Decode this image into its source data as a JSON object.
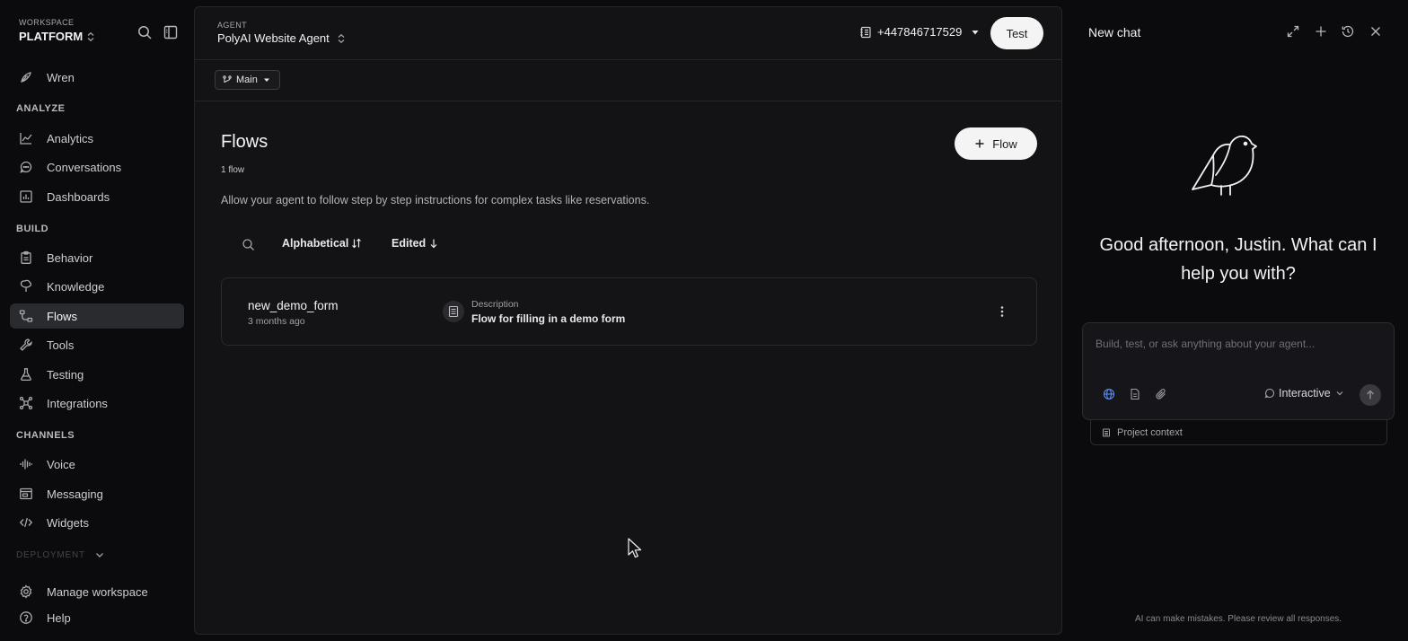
{
  "workspace": {
    "label": "WORKSPACE",
    "name": "PLATFORM"
  },
  "sidebar": {
    "top_items": [
      {
        "label": "Wren",
        "icon": "feather-icon"
      }
    ],
    "sections": [
      {
        "title": "ANALYZE",
        "items": [
          {
            "label": "Analytics",
            "icon": "chart-line-icon"
          },
          {
            "label": "Conversations",
            "icon": "chat-bubble-icon"
          },
          {
            "label": "Dashboards",
            "icon": "dashboard-icon"
          }
        ]
      },
      {
        "title": "BUILD",
        "items": [
          {
            "label": "Behavior",
            "icon": "clipboard-icon"
          },
          {
            "label": "Knowledge",
            "icon": "brain-icon"
          },
          {
            "label": "Flows",
            "icon": "flows-icon",
            "active": true
          },
          {
            "label": "Tools",
            "icon": "wrench-icon"
          },
          {
            "label": "Testing",
            "icon": "flask-icon"
          },
          {
            "label": "Integrations",
            "icon": "network-icon"
          }
        ]
      },
      {
        "title": "CHANNELS",
        "items": [
          {
            "label": "Voice",
            "icon": "waveform-icon"
          },
          {
            "label": "Messaging",
            "icon": "message-window-icon"
          },
          {
            "label": "Widgets",
            "icon": "code-icon"
          }
        ]
      }
    ],
    "deployment_label": "DEPLOYMENT",
    "bottom_items": [
      {
        "label": "Manage workspace",
        "icon": "gear-icon"
      },
      {
        "label": "Help",
        "icon": "help-circle-icon"
      }
    ]
  },
  "header": {
    "agent_label": "AGENT",
    "agent_name": "PolyAI Website Agent",
    "phone_number": "+447846717529",
    "test_label": "Test",
    "branch_label": "Main"
  },
  "main": {
    "title": "Flows",
    "count_text": "1 flow",
    "description": "Allow your agent to follow step by step instructions for complex tasks like reservations.",
    "add_button_label": "Flow",
    "sort_alpha_label": "Alphabetical",
    "sort_edited_label": "Edited",
    "flows": [
      {
        "name": "new_demo_form",
        "edited": "3 months ago",
        "description_label": "Description",
        "description": "Flow for filling in a demo form"
      }
    ]
  },
  "chat": {
    "title": "New chat",
    "greeting": "Good afternoon, Justin. What can I help you with?",
    "input_placeholder": "Build, test, or ask anything about your agent...",
    "mode_label": "Interactive",
    "context_label": "Project context",
    "disclaimer": "AI can make mistakes. Please review all responses."
  },
  "colors": {
    "background": "#0b0b0d",
    "panel": "#131316",
    "active_nav": "#2a2b2f",
    "button_light": "#f4f4f5",
    "globe_accent": "#5b8def"
  }
}
